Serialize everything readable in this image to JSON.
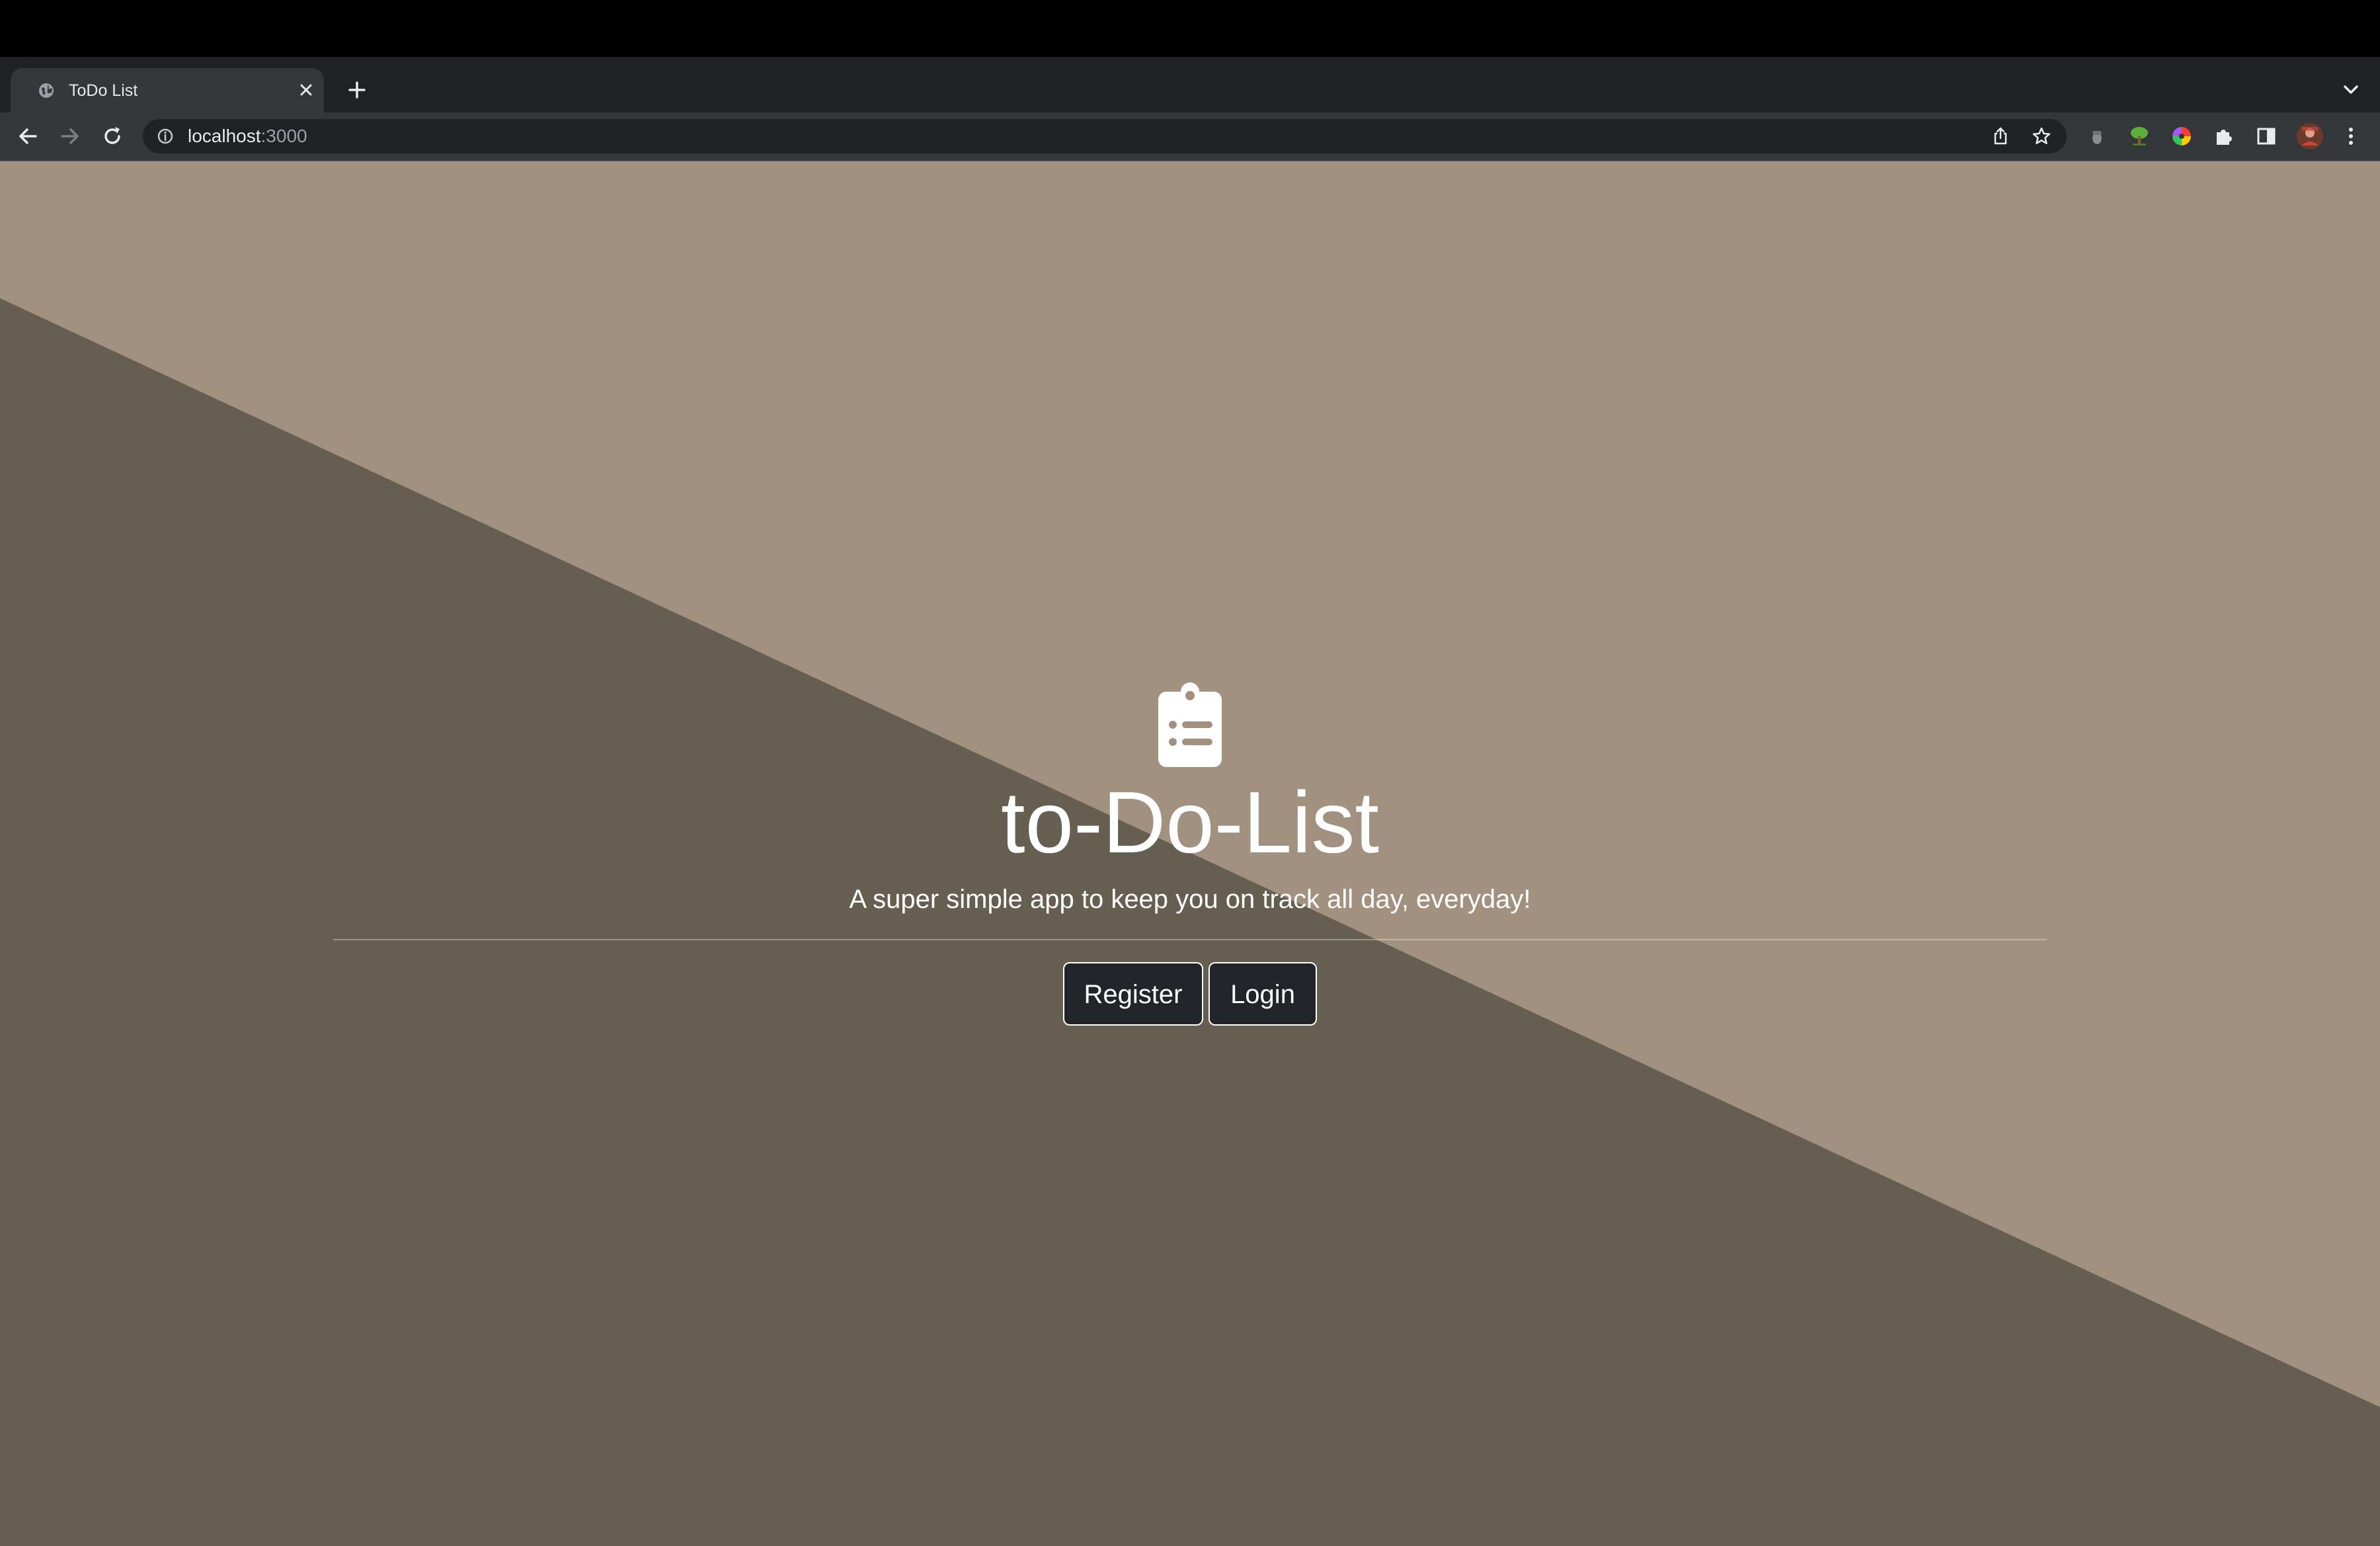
{
  "browser": {
    "tab": {
      "title": "ToDo List",
      "favicon": "globe-icon"
    },
    "address_bar": {
      "host": "localhost",
      "port": ":3000"
    },
    "toolbar_icons": [
      "back-icon",
      "forward-icon",
      "reload-icon",
      "info-icon",
      "share-icon",
      "bookmark-star-icon",
      "extension-acorn-icon",
      "extension-tree-icon",
      "extension-color-wheel-icon",
      "extensions-puzzle-icon",
      "side-panel-icon",
      "profile-avatar",
      "menu-kebab-icon"
    ]
  },
  "hero": {
    "icon": "clipboard-list-icon",
    "title": "to-Do-List",
    "subtitle": "A super simple app to keep you on track all day, everyday!",
    "buttons": {
      "register": "Register",
      "login": "Login"
    }
  },
  "colors": {
    "background_light": "#a39180",
    "background_dark": "#675e52",
    "button_bg": "#212529",
    "text": "#ffffff"
  }
}
